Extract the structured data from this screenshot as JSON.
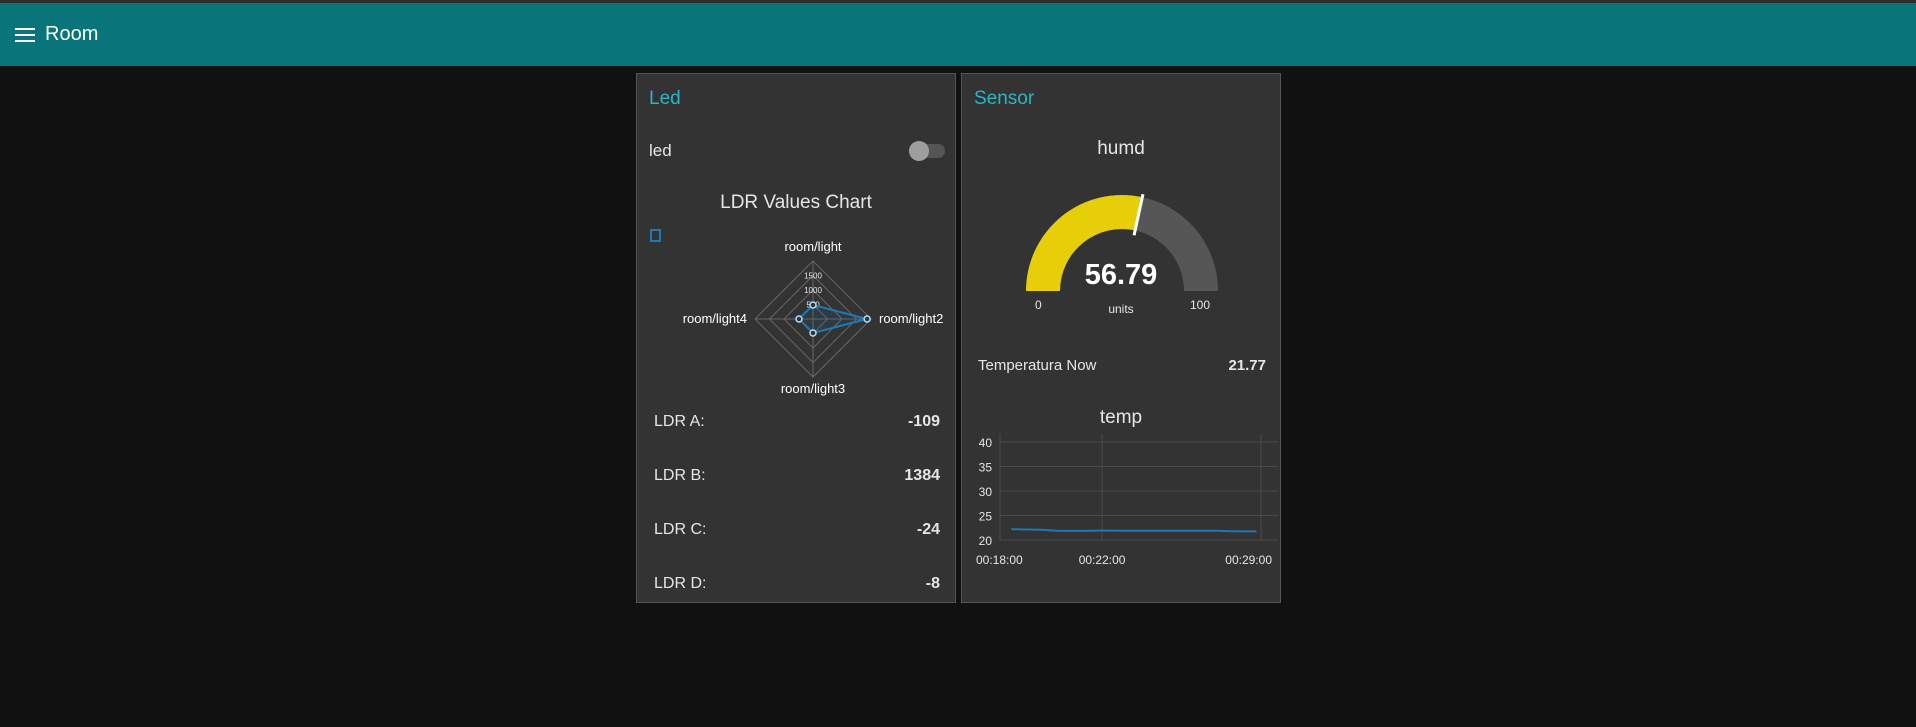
{
  "header": {
    "title": "Room"
  },
  "led_group": {
    "title": "Led",
    "switch_label": "led",
    "switch_on": false,
    "ldr_rows": [
      {
        "label": "LDR A:",
        "value": "-109"
      },
      {
        "label": "LDR B:",
        "value": "1384"
      },
      {
        "label": "LDR C:",
        "value": "-24"
      },
      {
        "label": "LDR D:",
        "value": "-8"
      }
    ]
  },
  "sensor_group": {
    "title": "Sensor",
    "gauge": {
      "title": "humd",
      "value": "56.79",
      "units": "units",
      "min": "0",
      "max": "100",
      "color": "#e6cf08"
    },
    "temperature": {
      "label": "Temperatura Now",
      "value": "21.77"
    }
  },
  "chart_data": [
    {
      "type": "radar",
      "title": "LDR Values Chart",
      "categories": [
        "room/light",
        "room/light2",
        "room/light3",
        "room/light4"
      ],
      "scale_ticks": [
        500,
        1000,
        1500
      ],
      "rmax": 2000,
      "series": [
        {
          "values": [
            -109,
            1384,
            -24,
            -8
          ],
          "color": "#1f77b4"
        }
      ],
      "legend": "top-left"
    },
    {
      "type": "line",
      "title": "temp",
      "ylim": [
        20,
        40
      ],
      "yticks": [
        20,
        25,
        30,
        35,
        40
      ],
      "xticks": [
        "00:18:00",
        "00:22:00",
        "00:29:00"
      ],
      "series": [
        {
          "color": "#1f77b4",
          "x": [
            "00:18:00",
            "00:18:40",
            "00:19:20",
            "00:19:40",
            "00:20:00",
            "00:20:30",
            "00:21:00",
            "00:21:40",
            "00:22:00",
            "00:23:00",
            "00:24:00",
            "00:25:00",
            "00:26:00",
            "00:27:00",
            "00:27:30",
            "00:28:00",
            "00:28:48"
          ],
          "values": [
            22.2,
            22.15,
            22.1,
            22.0,
            21.9,
            21.85,
            21.85,
            21.9,
            21.95,
            21.9,
            21.9,
            21.9,
            21.9,
            21.9,
            21.8,
            21.77,
            21.77
          ]
        }
      ],
      "grid": true
    }
  ]
}
